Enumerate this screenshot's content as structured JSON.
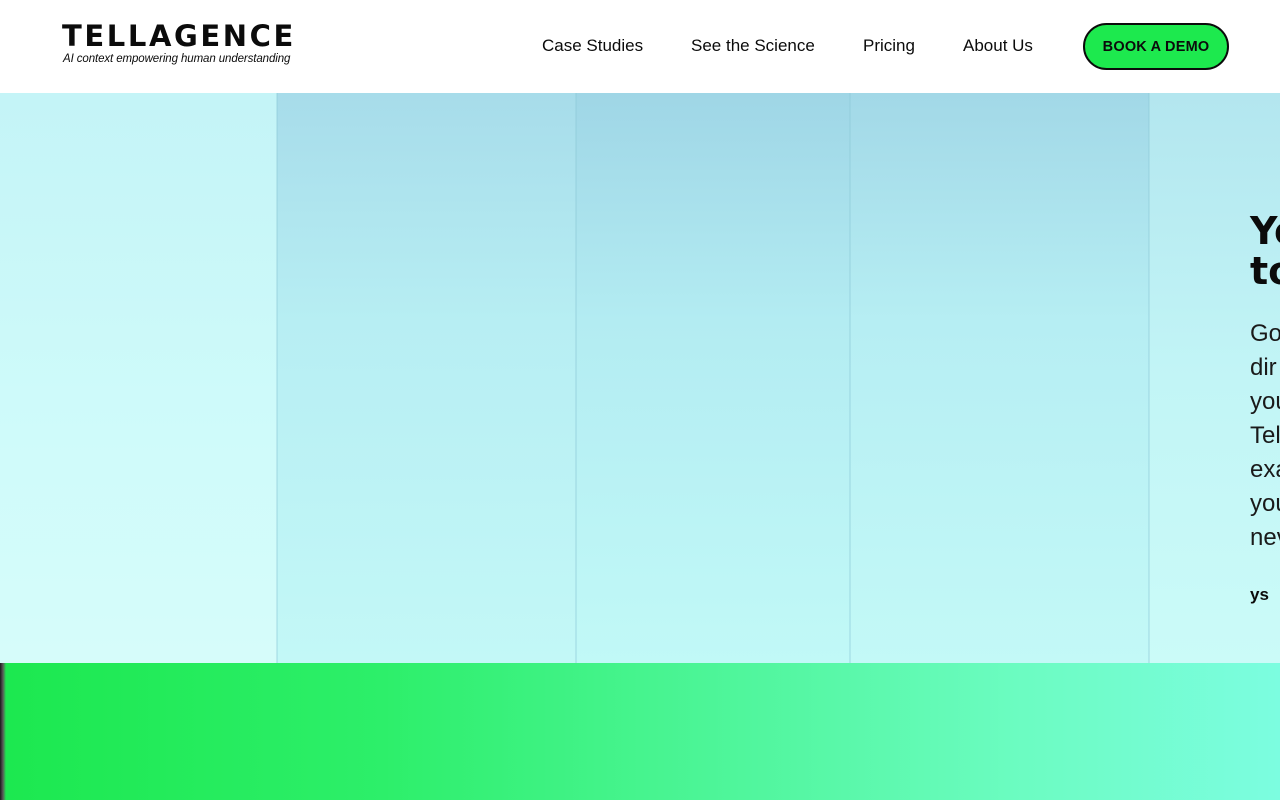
{
  "header": {
    "logo": {
      "wordmark": "TELLAGENCE",
      "tagline": "AI context empowering human understanding"
    },
    "nav": [
      {
        "label": "Case Studies"
      },
      {
        "label": "See the Science"
      },
      {
        "label": "Pricing"
      },
      {
        "label": "About Us"
      }
    ],
    "cta_label": "BOOK A DEMO"
  },
  "hero": {
    "title": "Yo\nto",
    "body": "Go\ndir\nyou\nTel\nexa\nyou\nnev",
    "link": "ys"
  },
  "colors": {
    "accent_green": "#1de94e",
    "text": "#0b0b0b",
    "hero_cyan": "#bdf5f6"
  }
}
